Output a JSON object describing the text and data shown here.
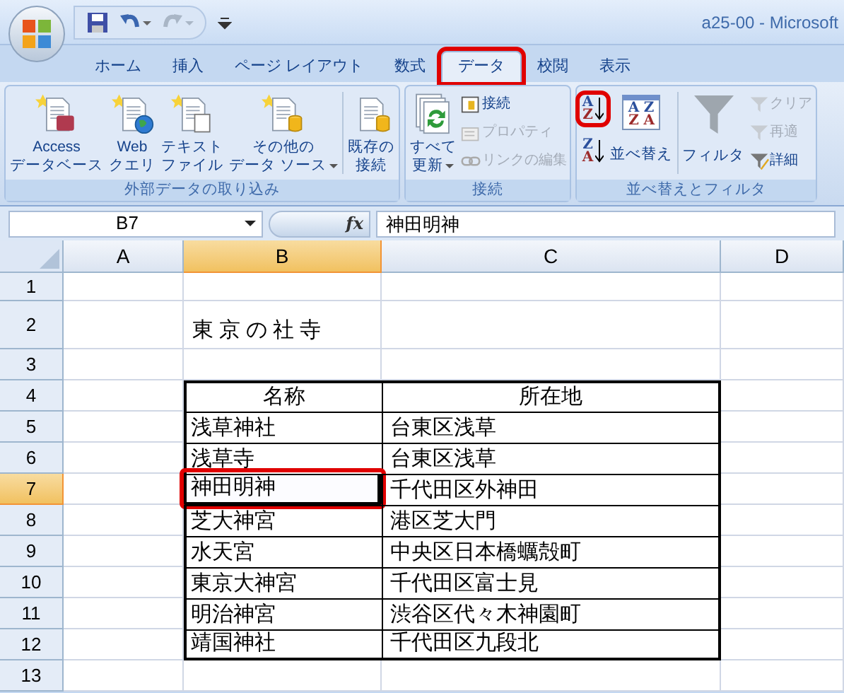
{
  "window": {
    "title": "a25-00 - Microsoft"
  },
  "tabs": [
    {
      "label": "ホーム",
      "selected": false,
      "highlighted": false
    },
    {
      "label": "挿入",
      "selected": false,
      "highlighted": false
    },
    {
      "label": "ページ レイアウト",
      "selected": false,
      "highlighted": false
    },
    {
      "label": "数式",
      "selected": false,
      "highlighted": false
    },
    {
      "label": "データ",
      "selected": true,
      "highlighted": true
    },
    {
      "label": "校閲",
      "selected": false,
      "highlighted": false
    },
    {
      "label": "表示",
      "selected": false,
      "highlighted": false
    }
  ],
  "ribbon_groups": [
    {
      "title": "外部データの取り込み",
      "items": [
        {
          "kind": "large",
          "lines": [
            "Access",
            "データベース"
          ],
          "dropdown": false
        },
        {
          "kind": "large",
          "lines": [
            "Web",
            "クエリ"
          ],
          "dropdown": false
        },
        {
          "kind": "large",
          "lines": [
            "テキスト",
            "ファイル"
          ],
          "dropdown": false
        },
        {
          "kind": "large",
          "lines": [
            "その他の",
            "データ ソース"
          ],
          "dropdown": true
        },
        {
          "kind": "separator"
        },
        {
          "kind": "large",
          "lines": [
            "既存の",
            "接続"
          ],
          "dropdown": false
        }
      ]
    },
    {
      "title": "接続",
      "items": [
        {
          "kind": "large",
          "lines": [
            "すべて",
            "更新"
          ],
          "dropdown": true
        },
        {
          "kind": "smallstack",
          "buttons": [
            {
              "label": "接続",
              "disabled": false
            },
            {
              "label": "プロパティ",
              "disabled": true
            },
            {
              "label": "リンクの編集",
              "disabled": true
            }
          ]
        }
      ]
    },
    {
      "title": "並べ替えとフィルタ",
      "items": [
        {
          "kind": "sortstack",
          "buttons": [
            {
              "glyph": [
                "A",
                "Z"
              ],
              "highlighted": true
            },
            {
              "glyph": [
                "Z",
                "A"
              ],
              "highlighted": false
            }
          ]
        },
        {
          "kind": "sortbig",
          "glyph": [
            "A",
            "Z",
            "Z",
            "A"
          ],
          "label": "並べ替え"
        },
        {
          "kind": "separator"
        },
        {
          "kind": "filter",
          "label": "フィルタ"
        },
        {
          "kind": "smallstack",
          "buttons": [
            {
              "label": "クリア",
              "disabled": true
            },
            {
              "label": "再適",
              "disabled": true
            },
            {
              "label": "詳細",
              "disabled": false
            }
          ]
        }
      ]
    }
  ],
  "name_box": "B7",
  "function_label": "fx",
  "formula": "神田明神",
  "columns": [
    {
      "label": "A",
      "selected": false
    },
    {
      "label": "B",
      "selected": true
    },
    {
      "label": "C",
      "selected": false
    },
    {
      "label": "D",
      "selected": false
    }
  ],
  "rows": [
    {
      "header": "1",
      "selected": false,
      "kind": "empty"
    },
    {
      "header": "2",
      "selected": false,
      "kind": "title",
      "text": "東京の社寺"
    },
    {
      "header": "3",
      "selected": false,
      "kind": "empty"
    },
    {
      "header": "4",
      "selected": false,
      "kind": "header",
      "name": "名称",
      "location": "所在地"
    },
    {
      "header": "5",
      "selected": false,
      "kind": "entry",
      "name": "浅草神社",
      "location": "台東区浅草",
      "active": false,
      "highlighted": false
    },
    {
      "header": "6",
      "selected": false,
      "kind": "entry",
      "name": "浅草寺",
      "location": "台東区浅草",
      "active": false,
      "highlighted": false
    },
    {
      "header": "7",
      "selected": true,
      "kind": "entry",
      "name": "神田明神",
      "location": "千代田区外神田",
      "active": true,
      "highlighted": true
    },
    {
      "header": "8",
      "selected": false,
      "kind": "entry",
      "name": "芝大神宮",
      "location": "港区芝大門",
      "active": false,
      "highlighted": false
    },
    {
      "header": "9",
      "selected": false,
      "kind": "entry",
      "name": "水天宮",
      "location": "中央区日本橋蠣殻町",
      "active": false,
      "highlighted": false
    },
    {
      "header": "10",
      "selected": false,
      "kind": "entry",
      "name": "東京大神宮",
      "location": "千代田区富士見",
      "active": false,
      "highlighted": false
    },
    {
      "header": "11",
      "selected": false,
      "kind": "entry",
      "name": "明治神宮",
      "location": "渋谷区代々木神園町",
      "active": false,
      "highlighted": false
    },
    {
      "header": "12",
      "selected": false,
      "kind": "entry",
      "name": "靖国神社",
      "location": "千代田区九段北",
      "active": false,
      "highlighted": false
    },
    {
      "header": "13",
      "selected": false,
      "kind": "empty"
    }
  ]
}
